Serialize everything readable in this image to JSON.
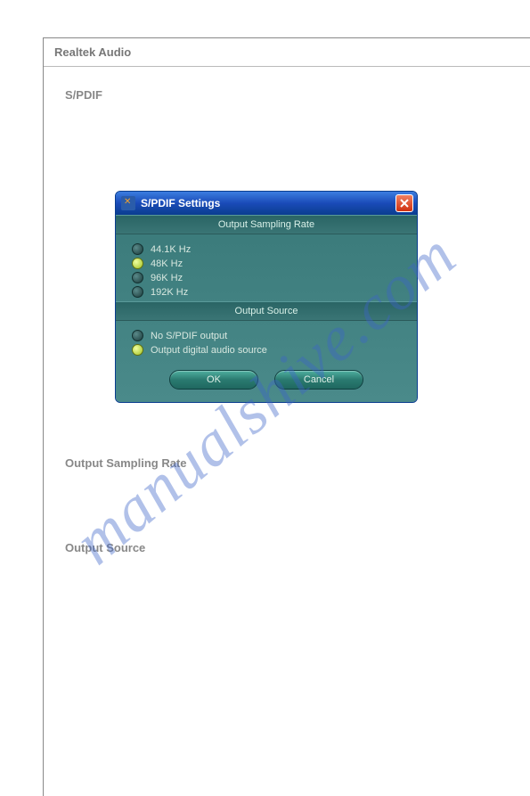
{
  "page": {
    "header": "Realtek Audio",
    "section": "S/PDIF",
    "sub1": "Output Sampling Rate",
    "sub2": "Output Source"
  },
  "dialog": {
    "title": "S/PDIF Settings",
    "groups": {
      "rate": {
        "header": "Output Sampling Rate",
        "options": [
          "44.1K Hz",
          "48K Hz",
          "96K Hz",
          "192K Hz"
        ],
        "selected": 1
      },
      "source": {
        "header": "Output Source",
        "options": [
          "No S/PDIF output",
          "Output digital audio source"
        ],
        "selected": 1
      }
    },
    "buttons": {
      "ok": "OK",
      "cancel": "Cancel"
    }
  },
  "watermark": "manualshive.com"
}
